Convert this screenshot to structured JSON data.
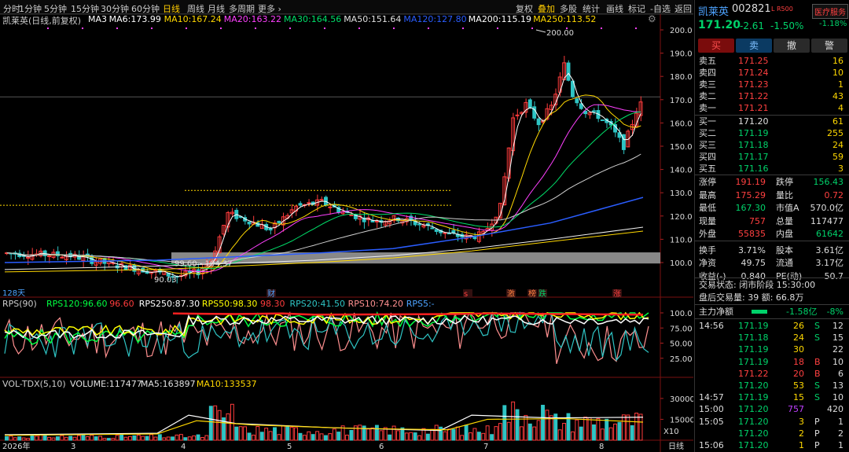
{
  "topbar": {
    "periods": [
      "分时",
      "1分钟",
      "5分钟",
      "15分钟",
      "30分钟",
      "60分钟",
      "日线",
      "周线",
      "月线",
      "多周期",
      "更多 ›"
    ],
    "tools": [
      "复权",
      "叠加",
      "多股",
      "统计",
      "画线",
      "标记",
      "-自选",
      "返回"
    ],
    "active_period": "日线",
    "active_tool": "叠加"
  },
  "main": {
    "title": "凯莱英(日线,前复权)",
    "ma": [
      {
        "label": "MA3",
        "value": "",
        "color": "#ffffff"
      },
      {
        "label": "MA6:",
        "value": "173.99",
        "color": "#ffffff"
      },
      {
        "label": "MA10:",
        "value": "167.24",
        "color": "#ffd800"
      },
      {
        "label": "MA20:",
        "value": "163.22",
        "color": "#ff40ff"
      },
      {
        "label": "MA30:",
        "value": "164.56",
        "color": "#00e06a"
      },
      {
        "label": "MA50:",
        "value": "151.64",
        "color": "#e0e0e0"
      },
      {
        "label": "MA120:",
        "value": "127.80",
        "color": "#2a5dff"
      },
      {
        "label": "MA200:",
        "value": "115.19",
        "color": "#ffffff"
      },
      {
        "label": "MA250:",
        "value": "113.52",
        "color": "#ffd800"
      }
    ],
    "y_ticks": [
      "200.0",
      "190.0",
      "180.0",
      "170.0",
      "160.0",
      "150.0",
      "140.0",
      "130.0",
      "120.0",
      "110.0",
      "100.0"
    ],
    "annot_high": "200.00",
    "annot_low": "90.03",
    "annot_range": "99.60 - 104.37",
    "days_label": "128天",
    "event_marks": [
      {
        "label": "财",
        "color": "#4da3ff"
      },
      {
        "label": "s",
        "color": "#ff4040"
      },
      {
        "label": "激",
        "color": "#ff8040"
      },
      {
        "label": "榜",
        "color": "#ff8040"
      },
      {
        "label": "跌",
        "color": "#00d26a"
      },
      {
        "label": "涨",
        "color": "#ff4040"
      }
    ]
  },
  "rps": {
    "title": "RPS(90)",
    "items": [
      {
        "label": "RPS120:",
        "value": "96.60",
        "color": "#00ff40"
      },
      {
        "label": "",
        "value": "96.60",
        "color": "#ff3c3c"
      },
      {
        "label": "RPS250:",
        "value": "87.30",
        "color": "#ffffff"
      },
      {
        "label": "RPS50:",
        "value": "98.30",
        "color": "#ffff00"
      },
      {
        "label": "",
        "value": "98.30",
        "color": "#ff3c3c"
      },
      {
        "label": "RPS20:",
        "value": "41.50",
        "color": "#2ec4c4"
      },
      {
        "label": "RPS10:",
        "value": "74.20",
        "color": "#ff9090"
      },
      {
        "label": "RPS5:",
        "value": "-",
        "color": "#4da3ff"
      }
    ],
    "y_ticks": [
      "100.0",
      "75.00",
      "50.00",
      "25.00"
    ]
  },
  "vol": {
    "title": "VOL-TDX(5,10)",
    "items": [
      {
        "label": "VOLUME:",
        "value": "117477",
        "color": "#e0e0e0"
      },
      {
        "label": "MA5:",
        "value": "163897",
        "color": "#e0e0e0"
      },
      {
        "label": "MA10:",
        "value": "133537",
        "color": "#ffd800"
      }
    ],
    "y_ticks": [
      "30000",
      "15000"
    ],
    "unit": "X10"
  },
  "xaxis": {
    "labels": [
      "2026年",
      "3",
      "4",
      "5",
      "6",
      "7",
      "8"
    ],
    "end_label": "日线"
  },
  "right": {
    "name": "凯莱英",
    "code": "002821",
    "tag": "L R500",
    "sector": "医疗服务",
    "sector_chg": "-1.18%",
    "price": "171.20",
    "change": "-2.61",
    "pct": "-1.50%",
    "buttons": [
      "买",
      "卖",
      "撤",
      "警"
    ],
    "asks": [
      {
        "label": "卖五",
        "price": "171.25",
        "vol": "16"
      },
      {
        "label": "卖四",
        "price": "171.24",
        "vol": "10"
      },
      {
        "label": "卖三",
        "price": "171.23",
        "vol": "1"
      },
      {
        "label": "卖二",
        "price": "171.22",
        "vol": "43"
      },
      {
        "label": "卖一",
        "price": "171.21",
        "vol": "4"
      }
    ],
    "bids": [
      {
        "label": "买一",
        "price": "171.20",
        "vol": "61"
      },
      {
        "label": "买二",
        "price": "171.19",
        "vol": "255"
      },
      {
        "label": "买三",
        "price": "171.18",
        "vol": "24"
      },
      {
        "label": "买四",
        "price": "171.17",
        "vol": "59"
      },
      {
        "label": "买五",
        "price": "171.16",
        "vol": "3"
      }
    ],
    "stats": [
      [
        "涨停",
        "191.19",
        "跌停",
        "156.43"
      ],
      [
        "最高",
        "175.29",
        "量比",
        "0.72"
      ],
      [
        "最低",
        "167.30",
        "市值A",
        "570.0亿"
      ],
      [
        "现量",
        "757",
        "总量",
        "117477"
      ],
      [
        "外盘",
        "55835",
        "内盘",
        "61642"
      ],
      [
        "换手",
        "3.71%",
        "股本",
        "3.61亿"
      ],
      [
        "净资",
        "49.75",
        "流通",
        "3.17亿"
      ],
      [
        "收益(-)",
        "0.840",
        "PE(动)",
        "50.7"
      ]
    ],
    "status": "交易状态: 闭市阶段 15:30:00",
    "after": "盘后交易量: 39  额: 66.8万",
    "netflow_label": "主力净额",
    "netflow_value": "-1.58亿",
    "netflow_pct": "-8%",
    "ticks": [
      {
        "time": "14:56",
        "price": "171.19",
        "vol": "26",
        "bs": "S",
        "n": "12"
      },
      {
        "time": "",
        "price": "171.18",
        "vol": "24",
        "bs": "S",
        "n": "15"
      },
      {
        "time": "",
        "price": "171.19",
        "vol": "30",
        "bs": "",
        "n": "22"
      },
      {
        "time": "",
        "price": "171.19",
        "vol": "18",
        "bs": "B",
        "n": "10"
      },
      {
        "time": "",
        "price": "171.22",
        "vol": "20",
        "bs": "B",
        "n": "6"
      },
      {
        "time": "",
        "price": "171.20",
        "vol": "53",
        "bs": "S",
        "n": "13"
      },
      {
        "time": "14:57",
        "price": "171.19",
        "vol": "15",
        "bs": "S",
        "n": "10"
      },
      {
        "time": "15:00",
        "price": "171.20",
        "vol": "757",
        "bs": "",
        "n": "420"
      },
      {
        "time": "15:05",
        "price": "171.20",
        "vol": "3",
        "bs": "P",
        "n": "1"
      },
      {
        "time": "",
        "price": "171.20",
        "vol": "2",
        "bs": "P",
        "n": "2"
      },
      {
        "time": "15:06",
        "price": "171.20",
        "vol": "1",
        "bs": "P",
        "n": "1"
      }
    ]
  }
}
